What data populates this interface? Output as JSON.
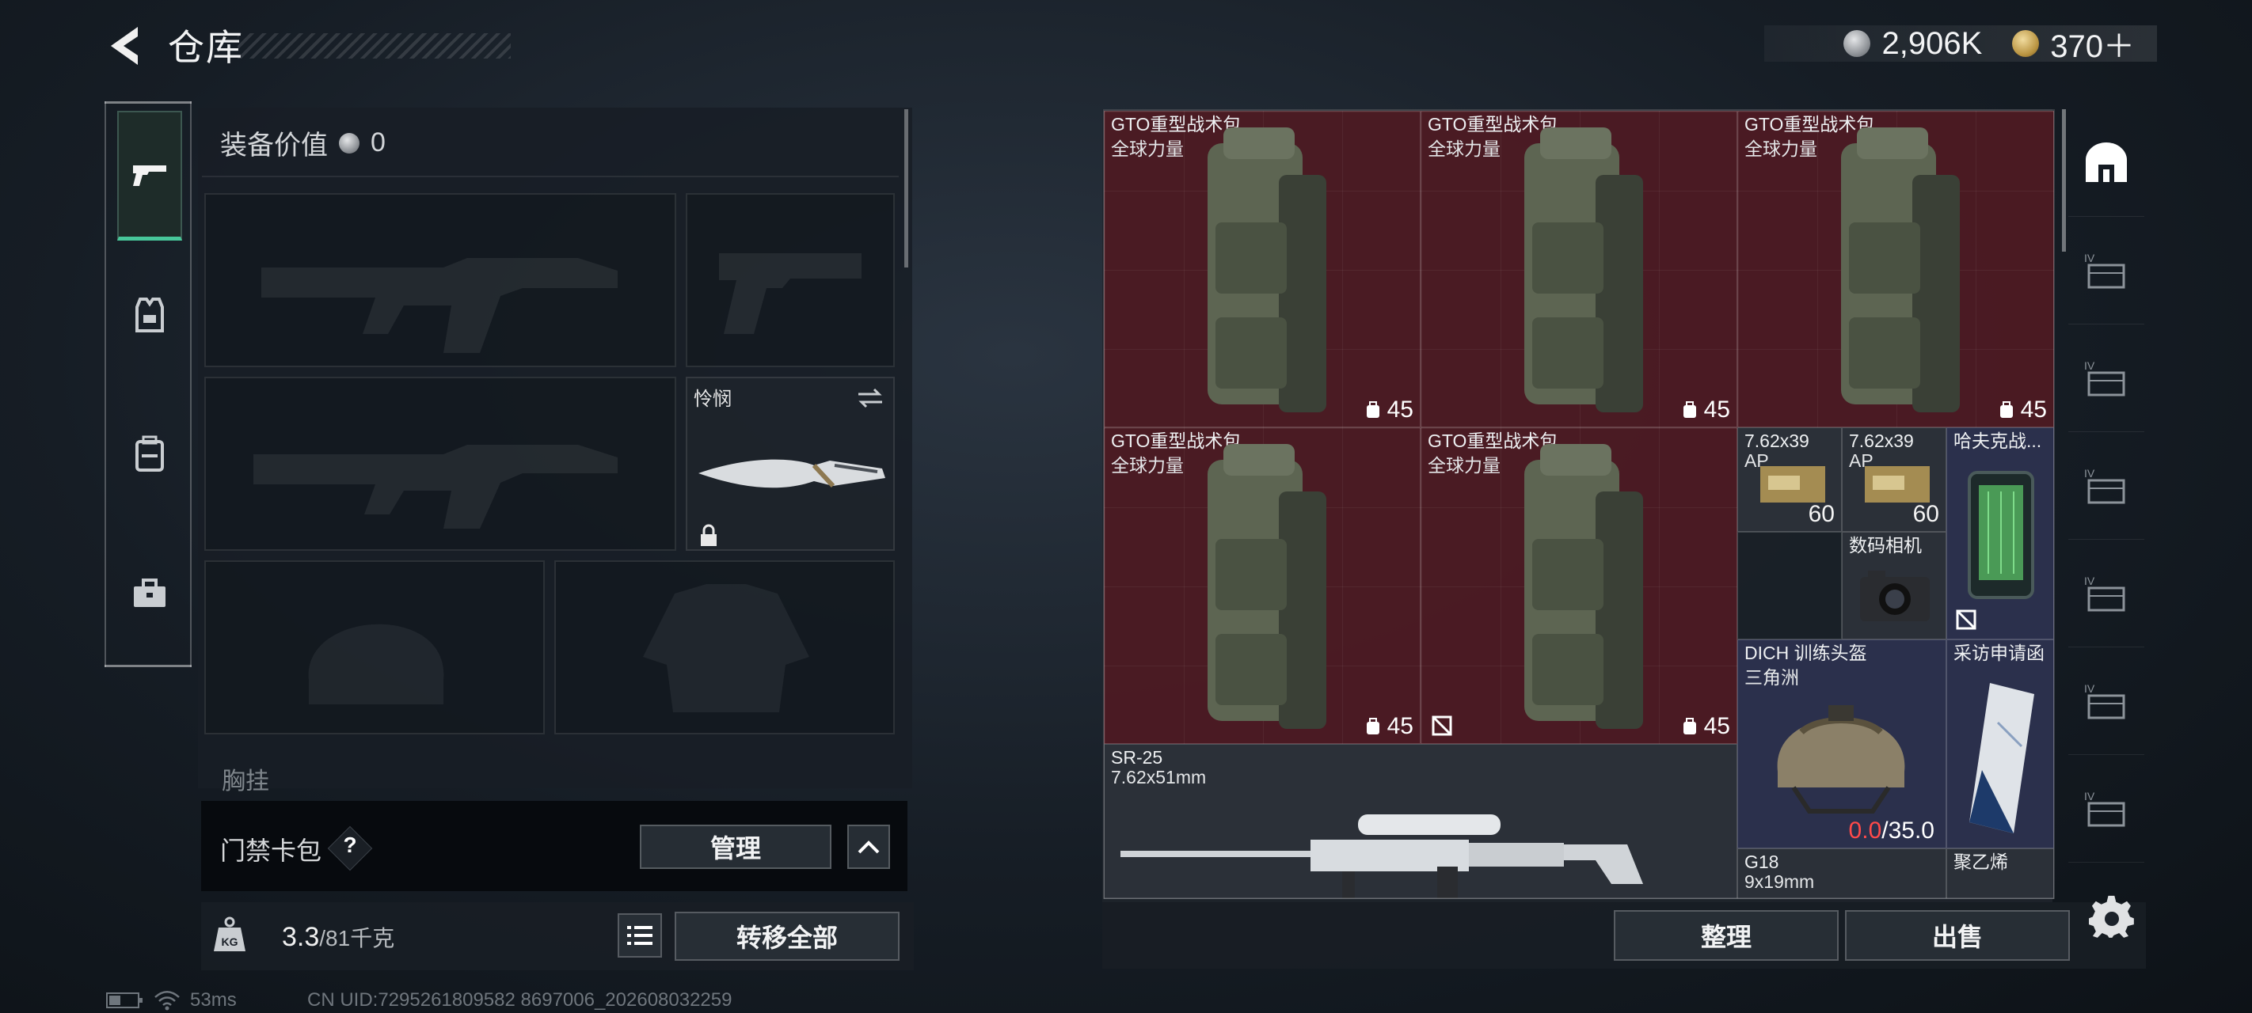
{
  "header": {
    "title": "仓库"
  },
  "currency": {
    "silver_value": "2,906K",
    "gold_value": "370＋"
  },
  "equipment": {
    "value_label": "装备价值",
    "value": "0",
    "melee_name": "怜悯",
    "chest_label": "胸挂",
    "keycard_label": "门禁卡包",
    "help_symbol": "?",
    "manage_label": "管理",
    "weight_current": "3.3",
    "weight_max": "/81千克",
    "kg_label": "KG",
    "transfer_all_label": "转移全部"
  },
  "status": {
    "ping": "53ms",
    "uid": "CN UID:7295261809582 8697006_202608032259"
  },
  "storage": {
    "items": [
      {
        "name": "GTO重型战术包",
        "sub": "全球力量",
        "capacity": "45"
      },
      {
        "name": "GTO重型战术包",
        "sub": "全球力量",
        "capacity": "45"
      },
      {
        "name": "GTO重型战术包",
        "sub": "全球力量",
        "capacity": "45"
      },
      {
        "name": "GTO重型战术包",
        "sub": "全球力量",
        "capacity": "45"
      },
      {
        "name": "GTO重型战术包",
        "sub": "全球力量",
        "capacity": "45"
      },
      {
        "name": "7.62x39",
        "sub": "AP",
        "count": "60"
      },
      {
        "name": "7.62x39",
        "sub": "AP",
        "count": "60"
      },
      {
        "name": "哈夫克战...",
        "sub": ""
      },
      {
        "name": "数码相机",
        "sub": ""
      },
      {
        "name": "DICH 训练头盔",
        "sub": "三角洲",
        "durability_current": "0.0",
        "durability_max": "/35.0"
      },
      {
        "name": "采访申请函",
        "sub": ""
      },
      {
        "name": "SR-25",
        "sub": "7.62x51mm"
      },
      {
        "name": "G18",
        "sub": "9x19mm"
      },
      {
        "name": "聚乙烯",
        "sub": ""
      }
    ],
    "sort_label": "整理",
    "sell_label": "出售",
    "side_tier_label": "IV"
  },
  "colors": {
    "accent_green": "#48c79a",
    "rare_red": "#5c1820",
    "epic_blue": "#2e3252",
    "warning_red": "#ff4a4a"
  }
}
